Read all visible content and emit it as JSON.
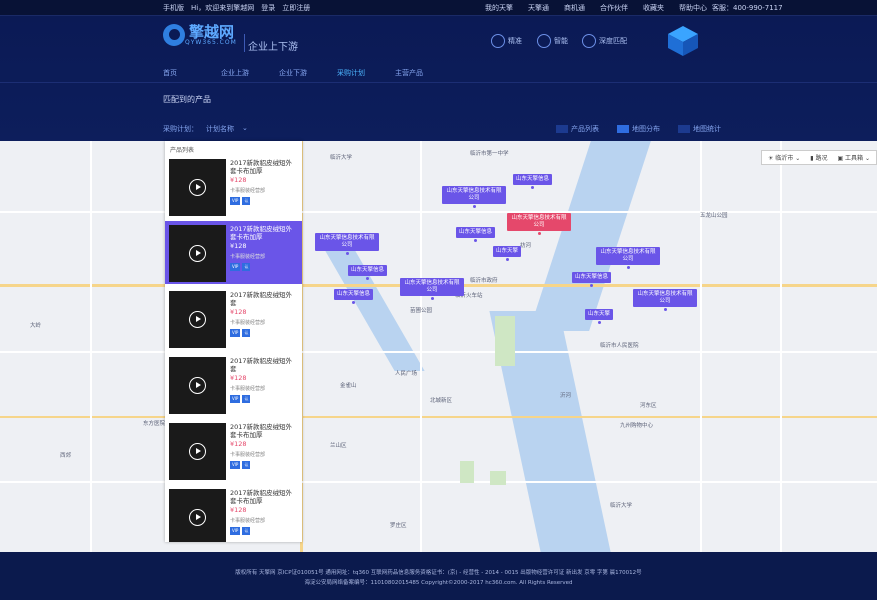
{
  "topbar": {
    "mobile": "手机版",
    "welcome": "Hi，欢迎来到擎越网",
    "login": "登录",
    "register": "立即注册",
    "links": [
      "我的天擎",
      "天擎通",
      "商机通",
      "合作伙伴",
      "收藏夹",
      "帮助中心"
    ],
    "service": "客服：400-990-7117"
  },
  "logo": {
    "name": "擎越网",
    "domain": "QYW365.COM"
  },
  "slogan": "企业上下游",
  "features": [
    "精准",
    "智能",
    "深度匹配"
  ],
  "nav": {
    "items": [
      "首页",
      "企业上游",
      "企业下游",
      "采购计划",
      "主营产品"
    ],
    "active_index": 3
  },
  "section_title": "匹配到的产品",
  "filter": {
    "label": "采购计划：",
    "value": "计划名称"
  },
  "views": [
    "产品列表",
    "地图分布",
    "地图统计"
  ],
  "panel": {
    "title": "产品列表",
    "items": [
      {
        "title": "2017新款貂皮绒短外套卡布加厚",
        "price": "¥128",
        "shop": "卡事服装经营部",
        "vip": "VIP",
        "badge": "认",
        "selected": false
      },
      {
        "title": "2017新款貂皮绒短外套卡布加厚",
        "price": "¥128",
        "shop": "卡事服装经营部",
        "vip": "VIP",
        "badge": "认",
        "selected": true
      },
      {
        "title": "2017新款貂皮绒短外套",
        "price": "¥128",
        "shop": "卡事服装经营部",
        "vip": "VIP",
        "badge": "认",
        "selected": false
      },
      {
        "title": "2017新款貂皮绒短外套",
        "price": "¥128",
        "shop": "卡事服装经营部",
        "vip": "VIP",
        "badge": "认",
        "selected": false
      },
      {
        "title": "2017新款貂皮绒短外套卡布加厚",
        "price": "¥128",
        "shop": "卡事服装经营部",
        "vip": "VIP",
        "badge": "认",
        "selected": false
      },
      {
        "title": "2017新款貂皮绒短外套卡布加厚",
        "price": "¥128",
        "shop": "卡事服装经营部",
        "vip": "VIP",
        "badge": "认",
        "selected": false
      }
    ]
  },
  "map": {
    "tools": {
      "city": "临沂市",
      "traffic": "路况",
      "toolbox": "工具箱"
    },
    "pins": [
      {
        "text": "山东天擎信息"
      },
      {
        "text": "山东天擎信息技术有限公司"
      },
      {
        "text": "山东天擎信息技术有限公司",
        "highlight": true
      },
      {
        "text": "山东天擎信息"
      },
      {
        "text": "山东天擎信息技术有限公司"
      },
      {
        "text": "山东天擎"
      },
      {
        "text": "山东天擎信息技术有限公司"
      },
      {
        "text": "山东天擎信息"
      },
      {
        "text": "山东天擎信息技术有限公司"
      },
      {
        "text": "山东天擎信息"
      },
      {
        "text": "山东天擎信息"
      },
      {
        "text": "山东天擎信息技术有限公司"
      },
      {
        "text": "山东天擎"
      }
    ],
    "places": [
      "临沂市第一中学",
      "临沂火车站",
      "临沂市人民医院",
      "临沂大学",
      "苗圃公园",
      "西郊",
      "大岭",
      "东方医院",
      "临沂市政府",
      "人民广场",
      "北城新区",
      "兰山区",
      "罗庄区",
      "河东区",
      "沂河",
      "祊河",
      "临沂大学",
      "九州购物中心",
      "五龙山公园",
      "金雀山"
    ]
  },
  "footer": {
    "line1": "版权所有 天擎网 京ICP证010051号 通用网址：tq360 互联网药品信息服务资格证书：(京) - 经营性 - 2014 - 0015 出版物经营许可证 新出发 京零 字第 晨170012号",
    "line2": "海淀公安局网络备案编号：11010802015485      Copyright©2000-2017 hc360.com. All Rights Reserved"
  }
}
